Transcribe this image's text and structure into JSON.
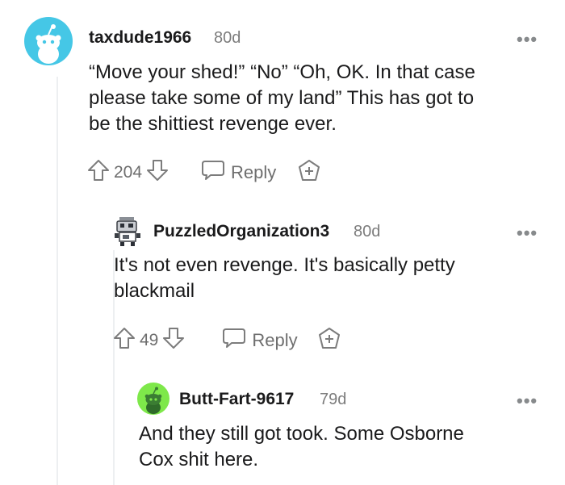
{
  "comments": [
    {
      "username": "taxdude1966",
      "age": "80d",
      "body": [
        "“Move your shed!” “No” “Oh, OK. In that case",
        "please take some of my land” This has got to",
        "be the shittiest revenge ever."
      ],
      "votes": "204",
      "reply_label": "Reply",
      "avatar_color": "#45c7e6"
    },
    {
      "username": "PuzzledOrganization3",
      "age": "80d",
      "body": [
        "It's not even revenge. It's basically petty",
        "blackmail"
      ],
      "votes": "49",
      "reply_label": "Reply"
    },
    {
      "username": "Butt-Fart-9617",
      "age": "79d",
      "body": [
        "And they still got took. Some Osborne",
        "Cox shit here."
      ],
      "avatar_color": "#7ee84a"
    }
  ],
  "icons": {
    "more": "more-options-icon",
    "upvote": "upvote-arrow-icon",
    "downvote": "downvote-arrow-icon",
    "reply": "speech-bubble-icon",
    "award": "award-plus-icon"
  },
  "more_glyph": "•••"
}
